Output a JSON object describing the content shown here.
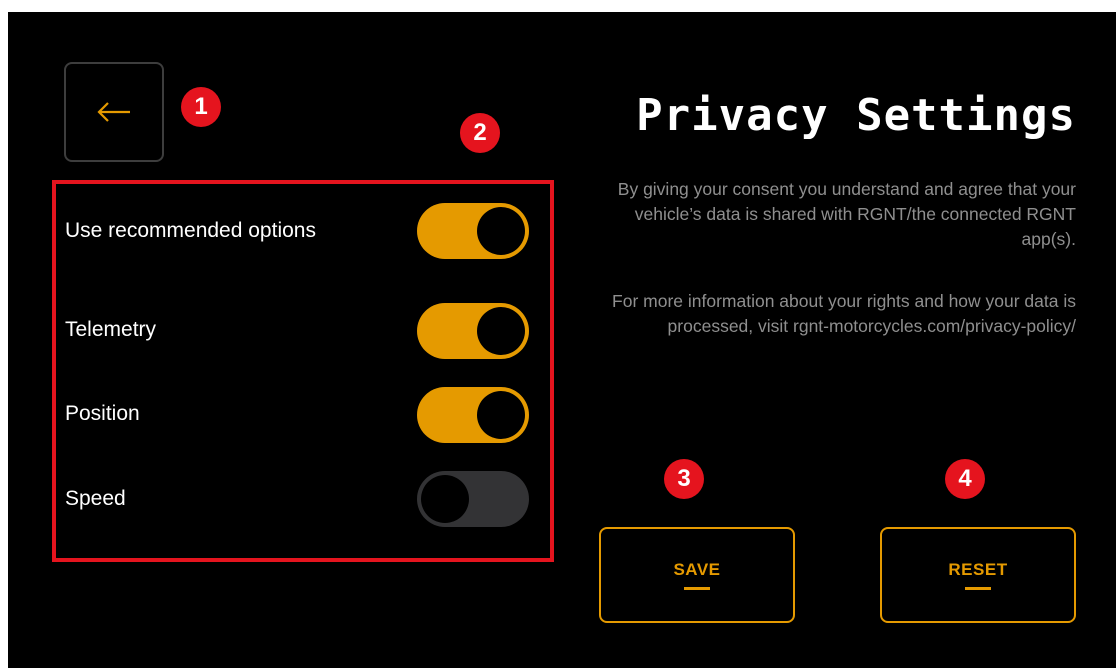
{
  "header": {
    "title": "Privacy Settings",
    "back_icon": "arrow-left-icon"
  },
  "markers": [
    "1",
    "2",
    "3",
    "4"
  ],
  "options": [
    {
      "label": "Use recommended options",
      "enabled": true
    },
    {
      "label": "Telemetry",
      "enabled": true
    },
    {
      "label": "Position",
      "enabled": true
    },
    {
      "label": "Speed",
      "enabled": false
    }
  ],
  "description": {
    "consent": "By giving your consent you understand and agree that your vehicle’s data is shared with RGNT/the connected RGNT app(s).",
    "rights": "For more information about your rights and how your data is processed, visit rgnt-motorcycles.com/privacy-policy/"
  },
  "buttons": {
    "save_label": "SAVE",
    "reset_label": "RESET"
  },
  "colors": {
    "accent": "#e59a00",
    "background": "#000000",
    "toggle_off": "#333335",
    "marker": "#e5141e"
  }
}
